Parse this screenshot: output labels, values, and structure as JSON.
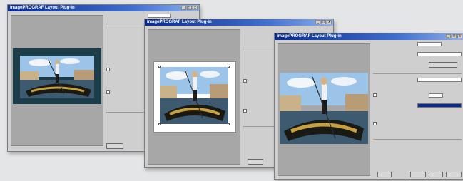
{
  "windows": {
    "back": {
      "title": "imagePROGRAF Layout Plug-in",
      "min": "_",
      "max": "□",
      "close": "x"
    },
    "middle": {
      "title": "imagePROGRAF Layout Plug-in",
      "min": "_",
      "max": "□",
      "close": "x"
    },
    "front": {
      "title": "imagePROGRAF Layout Plug-in",
      "min": "_",
      "max": "□",
      "close": "x"
    }
  },
  "colors": {
    "titlebar": "#0a2a8e",
    "preview_bg": "#a7a7a7",
    "selection": "#0a2a8e"
  }
}
